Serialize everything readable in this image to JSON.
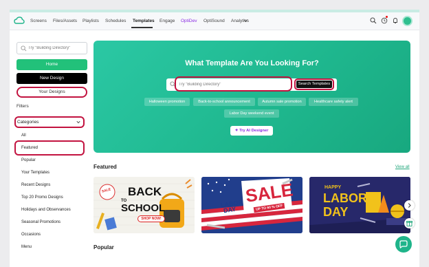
{
  "nav": {
    "items": [
      "Screens",
      "Files/Assets",
      "Playlists",
      "Schedules",
      "Templates",
      "Engage",
      "OptiDev",
      "OptiSound",
      "Analytics"
    ],
    "active": "Templates"
  },
  "sidebar": {
    "search_placeholder": "Try \"Building Directory\"",
    "home_label": "Home",
    "new_design_label": "New Design",
    "your_designs_label": "Your Designs",
    "filters_label": "Filters",
    "categories_label": "Categories",
    "items": [
      "All",
      "Featured",
      "Popular",
      "Your Templates",
      "Recent Designs",
      "Top 20 Promo Designs",
      "Holidays and Observances",
      "Seasonal Promotions",
      "Occasions",
      "Menu"
    ]
  },
  "hero": {
    "title": "What Template Are You Looking For?",
    "search_placeholder": "Try \"Building Directory\"",
    "search_button": "Search Templates",
    "chips": [
      "Halloween promotion",
      "Back-to-school announcement",
      "Autumn sale promotion",
      "Healthcare safety alert",
      "Labor Day weekend event"
    ],
    "ai_button": "Try AI Designer"
  },
  "featured": {
    "heading": "Featured",
    "view_all": "View all",
    "cards": [
      {
        "line1": "BACK",
        "line2": "SCHOOL",
        "connector": "TO",
        "badge": "SALE",
        "cta": "SHOP NOW!"
      },
      {
        "line1": "LABOR",
        "line2": "DAY",
        "big": "SALE",
        "sub": "UP TO 60 % OFF"
      },
      {
        "line1": "HAPPY",
        "line2": "LABOR",
        "line3": "DAY"
      }
    ]
  },
  "popular": {
    "heading": "Popular"
  },
  "colors": {
    "accent": "#22c17a",
    "highlight": "#c2123f",
    "ai": "#8a2be2"
  }
}
